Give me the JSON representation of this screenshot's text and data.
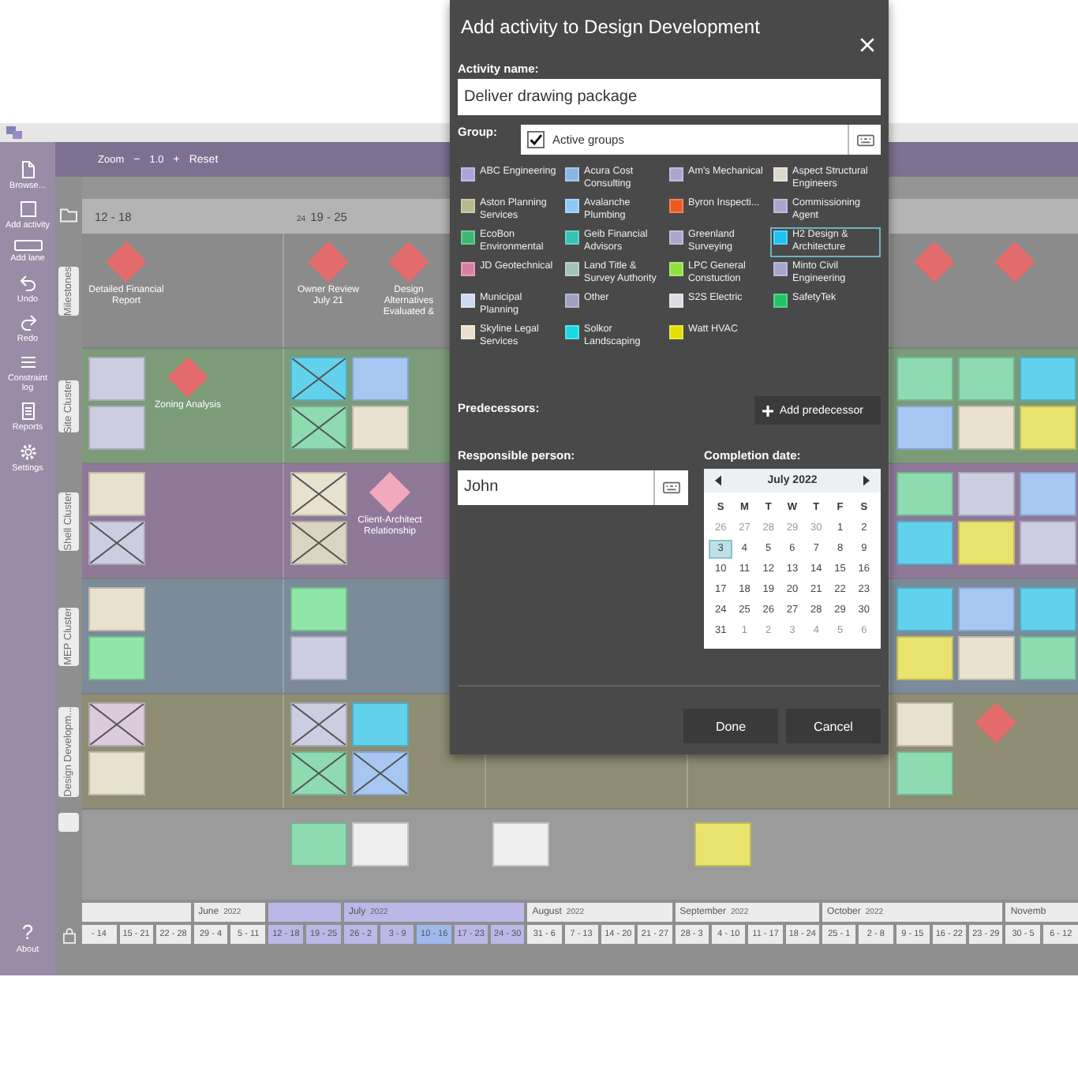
{
  "planner": {
    "sidebar": [
      {
        "kind": "browse",
        "label": "Browse..."
      },
      {
        "kind": "add-activity",
        "label": "Add activity"
      },
      {
        "kind": "add-lane",
        "label": "Add lane"
      },
      {
        "kind": "undo",
        "label": "Undo"
      },
      {
        "kind": "redo",
        "label": "Redo"
      },
      {
        "kind": "constraint-log",
        "label": "Constraint log"
      },
      {
        "kind": "reports",
        "label": "Reports"
      },
      {
        "kind": "settings",
        "label": "Settings"
      }
    ],
    "about": {
      "icon": "?",
      "label": "About"
    },
    "zoom": {
      "label": "Zoom",
      "minus": "−",
      "value": "1.0",
      "plus": "+",
      "reset": "Reset"
    },
    "week_headers": [
      {
        "range": "12 - 18"
      },
      {
        "week": "24",
        "range": "19 - 25"
      }
    ],
    "lanes": [
      {
        "label": "Milestones",
        "color": "#8b8b8b",
        "columns": [
          {
            "items": [
              {
                "kind": "milestone",
                "label": "Detailed Financial Report",
                "color": "#e36b6b"
              }
            ]
          },
          {
            "items": [
              {
                "kind": "milestone",
                "label": "Owner Review July 21",
                "color": "#e36b6b"
              },
              {
                "kind": "milestone",
                "label": "Design Alternatives Evaluated &",
                "color": "#e36b6b"
              }
            ]
          },
          {},
          {},
          {
            "items": [
              {
                "kind": "milestone",
                "color": "#e36b6b"
              },
              {
                "kind": "milestone",
                "color": "#e36b6b"
              }
            ]
          }
        ]
      },
      {
        "label": "Site Cluster",
        "color": "#7b9b79",
        "columns": [
          {
            "items": [
              {
                "kind": "note",
                "color": "#cdcde2",
                "done": false
              },
              {
                "kind": "note",
                "color": "#cdcde2",
                "done": false
              },
              {
                "kind": "milestone",
                "label": "Zoning Analysis",
                "color": "#e36b6b"
              }
            ]
          },
          {
            "items": [
              {
                "kind": "note",
                "color": "#62d2ec",
                "done": true
              },
              {
                "kind": "note",
                "color": "#8edbb2",
                "done": true
              },
              {
                "kind": "note",
                "color": "#a7c7f2",
                "done": false
              },
              {
                "kind": "note",
                "color": "#e7e1cd",
                "done": false
              }
            ]
          },
          {},
          {},
          {
            "items": [
              {
                "kind": "note",
                "color": "#8edbb2",
                "done": false
              },
              {
                "kind": "note",
                "color": "#a7c7f2",
                "done": false
              },
              {
                "kind": "note",
                "color": "#8edbb2",
                "done": false
              },
              {
                "kind": "note",
                "color": "#e7e1cd",
                "done": false
              },
              {
                "kind": "note",
                "color": "#62d2ec",
                "done": false
              },
              {
                "kind": "note",
                "color": "#e9e36e",
                "done": false
              }
            ]
          }
        ]
      },
      {
        "label": "Shell Cluster",
        "color": "#8f7898",
        "columns": [
          {
            "items": [
              {
                "kind": "note",
                "color": "#e7e1cd",
                "done": false
              },
              {
                "kind": "note",
                "color": "#cdcde2",
                "done": true
              }
            ]
          },
          {
            "items": [
              {
                "kind": "note",
                "color": "#e7e1cd",
                "done": true
              },
              {
                "kind": "note",
                "color": "#d9d5c2",
                "done": true
              },
              {
                "kind": "milestone",
                "label": "Client-Architect Relationship",
                "color": "#f2a9c0"
              }
            ]
          },
          {},
          {},
          {
            "items": [
              {
                "kind": "note",
                "color": "#8edbb2",
                "done": false
              },
              {
                "kind": "note",
                "color": "#62d2ec",
                "done": false
              },
              {
                "kind": "note",
                "color": "#cdcde2",
                "done": false
              },
              {
                "kind": "note",
                "color": "#e9e36e",
                "done": false
              },
              {
                "kind": "note",
                "color": "#a7c7f2",
                "done": false
              },
              {
                "kind": "note",
                "color": "#cdcde2",
                "done": false
              }
            ]
          }
        ]
      },
      {
        "label": "MEP Cluster",
        "color": "#7b8b99",
        "columns": [
          {
            "items": [
              {
                "kind": "note",
                "color": "#e7e1cd",
                "done": false
              },
              {
                "kind": "note",
                "color": "#8fe6a8",
                "done": false
              }
            ]
          },
          {
            "items": [
              {
                "kind": "note",
                "color": "#8fe6a8",
                "done": false
              },
              {
                "kind": "note",
                "color": "#cdcde2",
                "done": false
              }
            ]
          },
          {},
          {},
          {
            "items": [
              {
                "kind": "note",
                "color": "#62d2ec",
                "done": false
              },
              {
                "kind": "note",
                "color": "#e9e36e",
                "done": false
              },
              {
                "kind": "note",
                "color": "#a7c7f2",
                "done": false
              },
              {
                "kind": "note",
                "color": "#e7e1cd",
                "done": false
              },
              {
                "kind": "note",
                "color": "#62d2ec",
                "done": false
              },
              {
                "kind": "note",
                "color": "#8edbb2",
                "done": false
              }
            ]
          }
        ]
      },
      {
        "label": "Design Developm...",
        "color": "#8e8c73",
        "columns": [
          {
            "items": [
              {
                "kind": "note",
                "color": "#dccbdc",
                "done": true
              },
              {
                "kind": "note",
                "color": "#e7e1cd",
                "done": false
              }
            ]
          },
          {
            "items": [
              {
                "kind": "note",
                "color": "#cdcde2",
                "done": true
              },
              {
                "kind": "note",
                "color": "#8edbb2",
                "done": true
              },
              {
                "kind": "note",
                "color": "#62d2ec",
                "done": false
              },
              {
                "kind": "note",
                "color": "#a7c7f2",
                "done": true
              }
            ]
          },
          {},
          {},
          {
            "items": [
              {
                "kind": "note",
                "color": "#e7e1cd",
                "done": false
              },
              {
                "kind": "note",
                "color": "#8edbb2",
                "done": false
              },
              {
                "kind": "milestone",
                "color": "#e36b6b"
              }
            ]
          }
        ]
      }
    ],
    "bottom_area": {
      "columns": [
        {},
        {
          "items": [
            {
              "kind": "note",
              "color": "#8edbb2",
              "done": false
            },
            {
              "kind": "note",
              "color": "#efefef",
              "done": false
            }
          ]
        },
        {
          "items": [
            {
              "kind": "note",
              "color": "#efefef",
              "done": false
            }
          ]
        },
        {
          "items": [
            {
              "kind": "note",
              "color": "#e9e36e",
              "done": false
            }
          ]
        }
      ]
    },
    "timeline": {
      "months": [
        {
          "in_view": false,
          "weeks": [
            {
              "label": "- 14",
              "current": false
            },
            {
              "label": "15 - 21",
              "current": false
            },
            {
              "label": "22 - 28",
              "current": false
            }
          ]
        },
        {
          "label": "June",
          "year": "2022",
          "in_view": false,
          "weeks": [
            {
              "label": "29 - 4",
              "current": false
            },
            {
              "label": "5 - 11",
              "current": false
            }
          ]
        },
        {
          "in_view": true,
          "weeks": [
            {
              "label": "12 - 18",
              "current": false
            },
            {
              "label": "19 - 25",
              "current": false
            }
          ]
        },
        {
          "label": "July",
          "year": "2022",
          "in_view": true,
          "weeks": [
            {
              "label": "26 - 2",
              "current": false
            },
            {
              "label": "3 - 9",
              "current": false
            },
            {
              "label": "10 - 16",
              "current": true
            },
            {
              "label": "17 - 23",
              "current": false
            },
            {
              "label": "24 - 30",
              "current": false
            }
          ]
        },
        {
          "label": "August",
          "year": "2022",
          "in_view": false,
          "weeks": [
            {
              "label": "31 - 6",
              "current": false
            },
            {
              "label": "7 - 13",
              "current": false
            },
            {
              "label": "14 - 20",
              "current": false
            },
            {
              "label": "21 - 27",
              "current": false
            }
          ]
        },
        {
          "label": "September",
          "year": "2022",
          "in_view": false,
          "weeks": [
            {
              "label": "28 - 3",
              "current": false
            },
            {
              "label": "4 - 10",
              "current": false
            },
            {
              "label": "11 - 17",
              "current": false
            },
            {
              "label": "18 - 24",
              "current": false
            }
          ]
        },
        {
          "label": "October",
          "year": "2022",
          "in_view": false,
          "weeks": [
            {
              "label": "25 - 1",
              "current": false
            },
            {
              "label": "2 - 8",
              "current": false
            },
            {
              "label": "9 - 15",
              "current": false
            },
            {
              "label": "16 - 22",
              "current": false
            },
            {
              "label": "23 - 29",
              "current": false
            }
          ]
        },
        {
          "label": "Novemb",
          "in_view": false,
          "weeks": [
            {
              "label": "30 - 5",
              "current": false
            },
            {
              "label": "6 - 12",
              "current": false
            }
          ]
        }
      ]
    }
  },
  "dialog": {
    "title": "Add activity to Design Development",
    "activity": {
      "label": "Activity name:",
      "value": "Deliver drawing package"
    },
    "group": {
      "label": "Group:",
      "active_groups": {
        "label": "Active groups",
        "checked": true
      },
      "options": [
        {
          "name": "ABC Engineering",
          "color": "#a9a5d6",
          "selected": false
        },
        {
          "name": "Aston Planning Services",
          "color": "#b7b98c",
          "selected": false
        },
        {
          "name": "EcoBon Environmental",
          "color": "#3db870",
          "selected": false
        },
        {
          "name": "JD Geotechnical",
          "color": "#d97fa5",
          "selected": false
        },
        {
          "name": "Municipal Planning",
          "color": "#c9daf0",
          "selected": false
        },
        {
          "name": "Skyline Legal Services",
          "color": "#eadfce",
          "selected": false
        },
        {
          "name": "Acura Cost Consulting",
          "color": "#8ab6e6",
          "selected": false
        },
        {
          "name": "Avalanche Plumbing",
          "color": "#8ccaf5",
          "selected": false
        },
        {
          "name": "Geib Financial Advisors",
          "color": "#35c2b3",
          "selected": false
        },
        {
          "name": "Land Title & Survey Authority",
          "color": "#a3c2b3",
          "selected": false
        },
        {
          "name": "Other",
          "color": "#a09fc0",
          "selected": false
        },
        {
          "name": "Solkor Landscaping",
          "color": "#1ad9e0",
          "selected": false
        },
        {
          "name": "Am's Mechanical",
          "color": "#a9a7cc",
          "selected": false
        },
        {
          "name": "Byron Inspecti...",
          "color": "#ec5a22",
          "selected": false
        },
        {
          "name": "Greenland Surveying",
          "color": "#aaa8c9",
          "selected": false
        },
        {
          "name": "LPC General Constuction",
          "color": "#8fe040",
          "selected": false
        },
        {
          "name": "S2S Electric",
          "color": "#dcdce4",
          "selected": false
        },
        {
          "name": "Watt HVAC",
          "color": "#e3e000",
          "selected": false
        },
        {
          "name": "Aspect Structural Engineers",
          "color": "#dcd9cc",
          "selected": false
        },
        {
          "name": "Commissioning Agent",
          "color": "#a8a6cb",
          "selected": false
        },
        {
          "name": "H2 Design & Architecture",
          "color": "#1cc3f2",
          "selected": true
        },
        {
          "name": "Minto Civil Engineering",
          "color": "#a7a5ca",
          "selected": false
        },
        {
          "name": "SafetyTek",
          "color": "#1fc567",
          "selected": false
        }
      ]
    },
    "predecessors": {
      "label": "Predecessors:",
      "button": "Add predecessor"
    },
    "responsible": {
      "label": "Responsible person:",
      "value": "John"
    },
    "completion": {
      "label": "Completion date:",
      "calendar": {
        "month": "July 2022",
        "weekdays": [
          "S",
          "M",
          "T",
          "W",
          "T",
          "F",
          "S"
        ],
        "days": [
          {
            "day": "26",
            "outside_month": true,
            "selected": false
          },
          {
            "day": "27",
            "outside_month": true,
            "selected": false
          },
          {
            "day": "28",
            "outside_month": true,
            "selected": false
          },
          {
            "day": "29",
            "outside_month": true,
            "selected": false
          },
          {
            "day": "30",
            "outside_month": true,
            "selected": false
          },
          {
            "day": "1",
            "outside_month": false,
            "selected": false
          },
          {
            "day": "2",
            "outside_month": false,
            "selected": false
          },
          {
            "day": "3",
            "outside_month": false,
            "selected": true
          },
          {
            "day": "4",
            "outside_month": false,
            "selected": false
          },
          {
            "day": "5",
            "outside_month": false,
            "selected": false
          },
          {
            "day": "6",
            "outside_month": false,
            "selected": false
          },
          {
            "day": "7",
            "outside_month": false,
            "selected": false
          },
          {
            "day": "8",
            "outside_month": false,
            "selected": false
          },
          {
            "day": "9",
            "outside_month": false,
            "selected": false
          },
          {
            "day": "10",
            "outside_month": false,
            "selected": false
          },
          {
            "day": "11",
            "outside_month": false,
            "selected": false
          },
          {
            "day": "12",
            "outside_month": false,
            "selected": false
          },
          {
            "day": "13",
            "outside_month": false,
            "selected": false
          },
          {
            "day": "14",
            "outside_month": false,
            "selected": false
          },
          {
            "day": "15",
            "outside_month": false,
            "selected": false
          },
          {
            "day": "16",
            "outside_month": false,
            "selected": false
          },
          {
            "day": "17",
            "outside_month": false,
            "selected": false
          },
          {
            "day": "18",
            "outside_month": false,
            "selected": false
          },
          {
            "day": "19",
            "outside_month": false,
            "selected": false
          },
          {
            "day": "20",
            "outside_month": false,
            "selected": false
          },
          {
            "day": "21",
            "outside_month": false,
            "selected": false
          },
          {
            "day": "22",
            "outside_month": false,
            "selected": false
          },
          {
            "day": "23",
            "outside_month": false,
            "selected": false
          },
          {
            "day": "24",
            "outside_month": false,
            "selected": false
          },
          {
            "day": "25",
            "outside_month": false,
            "selected": false
          },
          {
            "day": "26",
            "outside_month": false,
            "selected": false
          },
          {
            "day": "27",
            "outside_month": false,
            "selected": false
          },
          {
            "day": "28",
            "outside_month": false,
            "selected": false
          },
          {
            "day": "29",
            "outside_month": false,
            "selected": false
          },
          {
            "day": "30",
            "outside_month": false,
            "selected": false
          },
          {
            "day": "31",
            "outside_month": false,
            "selected": false
          },
          {
            "day": "1",
            "outside_month": true,
            "selected": false
          },
          {
            "day": "2",
            "outside_month": true,
            "selected": false
          },
          {
            "day": "3",
            "outside_month": true,
            "selected": false
          },
          {
            "day": "4",
            "outside_month": true,
            "selected": false
          },
          {
            "day": "5",
            "outside_month": true,
            "selected": false
          },
          {
            "day": "6",
            "outside_month": true,
            "selected": false
          }
        ]
      }
    },
    "buttons": [
      "Done",
      "Cancel"
    ]
  }
}
